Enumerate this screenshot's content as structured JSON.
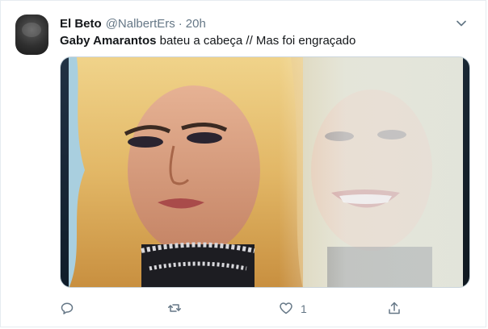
{
  "tweet": {
    "display_name": "El Beto",
    "handle": "@NalbertErs",
    "separator": "·",
    "time": "20h",
    "text_mention": "Gaby Amarantos",
    "text_body": " bateu a cabeça // Mas foi engraçado",
    "likes": "1"
  },
  "icons": {
    "more": "chevron-down-icon",
    "reply": "reply-icon",
    "retweet": "retweet-icon",
    "like": "heart-icon",
    "share": "share-icon"
  },
  "colors": {
    "name": "#14171a",
    "secondary": "#657786",
    "border": "#e6ecf0"
  }
}
